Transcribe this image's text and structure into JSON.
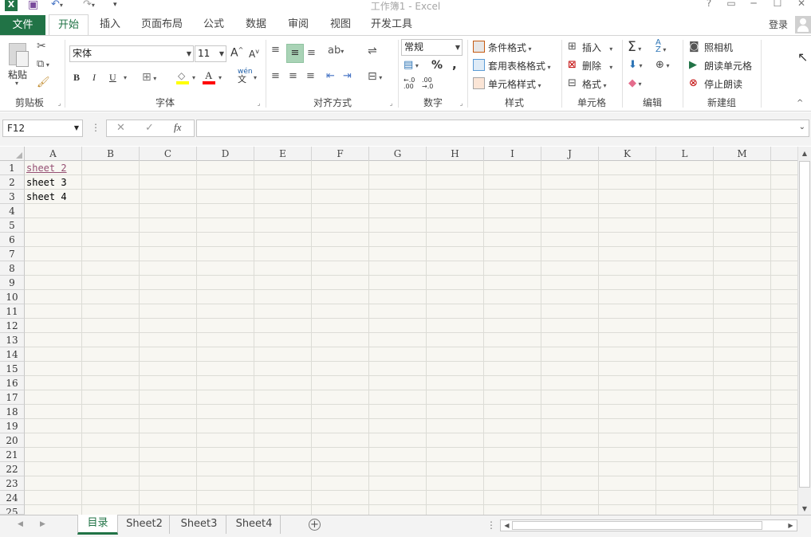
{
  "window": {
    "title": "工作簿1 - Excel",
    "quick_access": {
      "save": "save",
      "undo": "undo",
      "redo": "redo"
    },
    "controls": {
      "help": "?",
      "restore_ribbon": "▭",
      "minimize": "─",
      "maximize": "☐",
      "close": "✕"
    },
    "signin": "登录"
  },
  "tabs": [
    "文件",
    "开始",
    "插入",
    "页面布局",
    "公式",
    "数据",
    "审阅",
    "视图",
    "开发工具"
  ],
  "ribbon": {
    "clipboard": {
      "label": "剪贴板",
      "paste": "粘贴"
    },
    "font": {
      "label": "字体",
      "font_name": "宋体",
      "font_size": "11",
      "bold": "B",
      "italic": "I",
      "underline": "U",
      "wen": "wén",
      "wen_sub": "文"
    },
    "alignment": {
      "label": "对齐方式"
    },
    "number": {
      "label": "数字",
      "format": "常规",
      "percent": "%",
      "comma": ","
    },
    "styles": {
      "label": "样式",
      "conditional": "条件格式",
      "table": "套用表格格式",
      "cell_styles": "单元格样式"
    },
    "cells": {
      "label": "单元格",
      "insert": "插入",
      "delete": "删除",
      "format": "格式"
    },
    "editing": {
      "label": "编辑"
    },
    "new_group": {
      "label": "新建组",
      "camera": "照相机",
      "speak": "朗读单元格",
      "stop": "停止朗读"
    }
  },
  "formula_bar": {
    "name_box": "F12",
    "cancel": "✕",
    "enter": "✓",
    "fx": "fx",
    "value": ""
  },
  "columns": [
    "A",
    "B",
    "C",
    "D",
    "E",
    "F",
    "G",
    "H",
    "I",
    "J",
    "K",
    "L",
    "M"
  ],
  "rows": [
    "1",
    "2",
    "3",
    "4",
    "5",
    "6",
    "7",
    "8",
    "9",
    "10",
    "11",
    "12",
    "13",
    "14",
    "15",
    "16",
    "17",
    "18",
    "19",
    "20",
    "21",
    "22",
    "23",
    "24",
    "25"
  ],
  "cells": {
    "A1": "sheet 2",
    "A2": "sheet 3",
    "A3": "sheet 4"
  },
  "sheet_tabs": [
    "目录",
    "Sheet2",
    "Sheet3",
    "Sheet4"
  ],
  "active_sheet": "目录",
  "colors": {
    "accent": "#217346",
    "hyperlink": "#954f72"
  }
}
